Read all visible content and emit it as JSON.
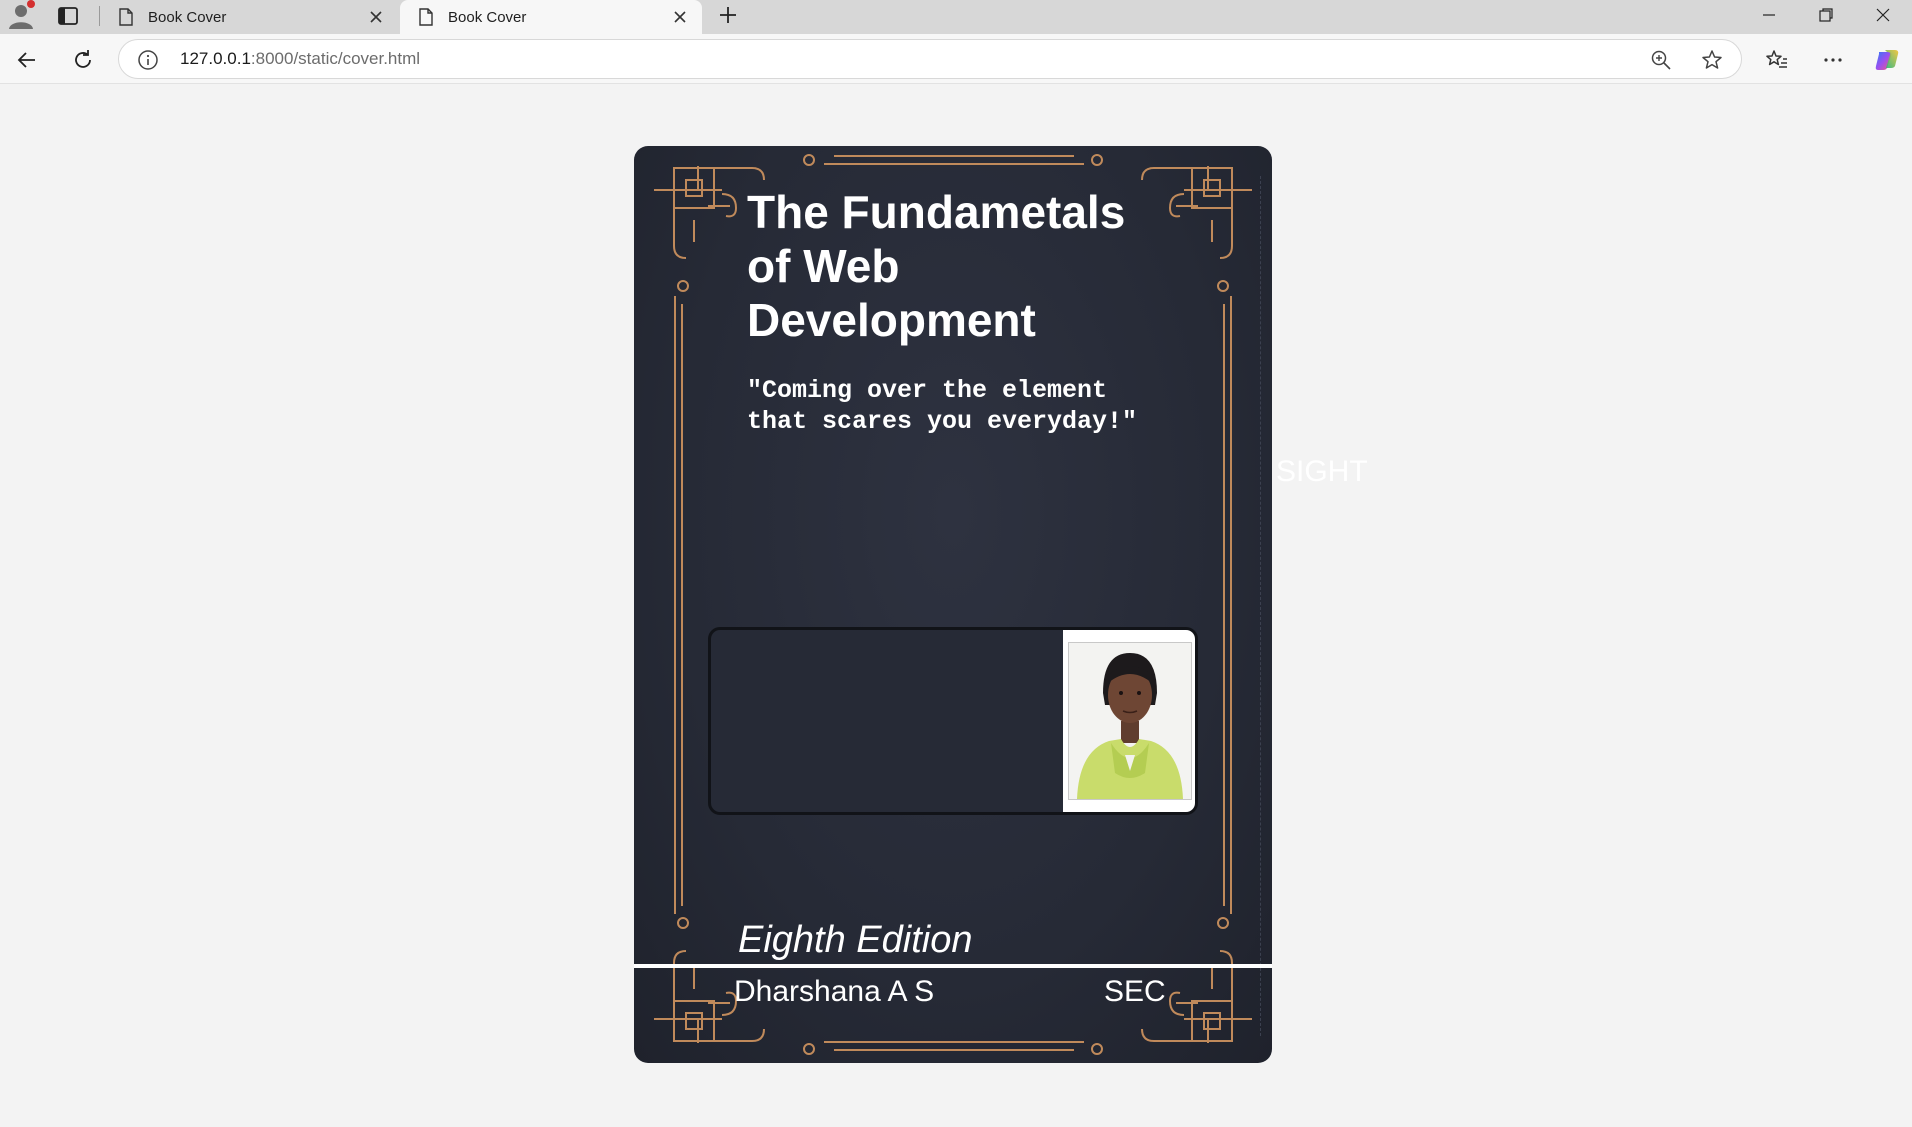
{
  "browser": {
    "tabs": [
      {
        "title": "Book Cover",
        "active": false
      },
      {
        "title": "Book Cover",
        "active": true
      }
    ],
    "address": {
      "host": "127.0.0.1",
      "path": ":8000/static/cover.html"
    },
    "icons": [
      "profile-icon",
      "tab-actions-icon",
      "page-icon",
      "close-icon",
      "new-tab-icon",
      "minimize-icon",
      "restore-icon",
      "window-close-icon",
      "back-icon",
      "refresh-icon",
      "site-info-icon",
      "zoom-icon",
      "favorite-star-icon",
      "favorites-icon",
      "more-icon",
      "copilot-icon"
    ]
  },
  "book": {
    "title": "The Fundametals of Web Development",
    "quote": "\"Coming over the element that scares you everyday!\"",
    "edition": "Eighth Edition",
    "author": "Dharshana A S",
    "publisher": "SEC",
    "ornament_color": "#c08a5b",
    "background_color": "#262a36"
  },
  "overflow_text": "SIGHT"
}
